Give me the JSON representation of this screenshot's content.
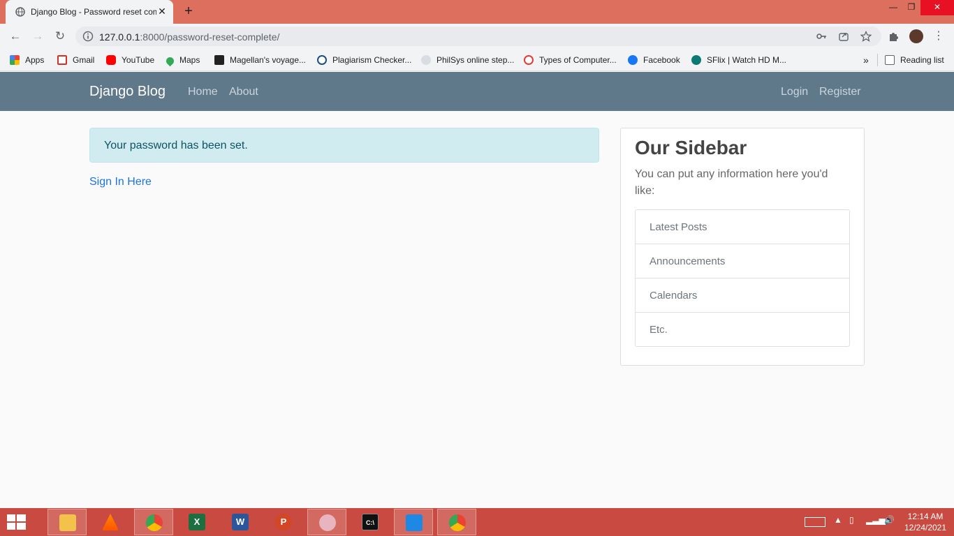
{
  "browser": {
    "tab_title": "Django Blog - Password reset complete",
    "url_host": "127.0.0.1",
    "url_rest": ":8000/password-reset-complete/",
    "bookmarks": [
      {
        "label": "Apps",
        "icon": "apps-grid-icon",
        "color": "#ea4335"
      },
      {
        "label": "Gmail",
        "icon": "gmail-icon",
        "color": "#d93025"
      },
      {
        "label": "YouTube",
        "icon": "youtube-icon",
        "color": "#ff0000"
      },
      {
        "label": "Maps",
        "icon": "maps-pin-icon",
        "color": "#34a853"
      },
      {
        "label": "Magellan's voyage...",
        "icon": "museum-icon",
        "color": "#222222"
      },
      {
        "label": "Plagiarism Checker...",
        "icon": "magnifier-icon",
        "color": "#1c4e80"
      },
      {
        "label": "PhilSys online step...",
        "icon": "philsys-icon",
        "color": "#8d99ae"
      },
      {
        "label": "Types of Computer...",
        "icon": "types-icon",
        "color": "#e53935"
      },
      {
        "label": "Facebook",
        "icon": "facebook-icon",
        "color": "#1877f2"
      },
      {
        "label": "SFlix | Watch HD M...",
        "icon": "sflix-icon",
        "color": "#0b7a75"
      }
    ],
    "reading_list": "Reading list",
    "overflow": "»"
  },
  "site": {
    "brand": "Django Blog",
    "nav_left": [
      "Home",
      "About"
    ],
    "nav_right": [
      "Login",
      "Register"
    ]
  },
  "main": {
    "alert": "Your password has been set.",
    "signin_link": "Sign In Here"
  },
  "sidebar": {
    "title": "Our Sidebar",
    "description": "You can put any information here you'd like:",
    "items": [
      "Latest Posts",
      "Announcements",
      "Calendars",
      "Etc."
    ]
  },
  "taskbar": {
    "time": "12:14 AM",
    "date": "12/24/2021",
    "apps": [
      "file-explorer-icon",
      "vlc-icon",
      "chrome-icon",
      "excel-icon",
      "word-icon",
      "powerpoint-icon",
      "snipping-tool-icon",
      "cmd-icon",
      "vscode-icon",
      "chrome-icon"
    ]
  },
  "colors": {
    "accent_navbar": "#5f788a",
    "alert_bg": "#d1ecf1",
    "link": "#1a73e8",
    "titlebar": "#dd6f5f",
    "taskbar": "#c94a40"
  }
}
